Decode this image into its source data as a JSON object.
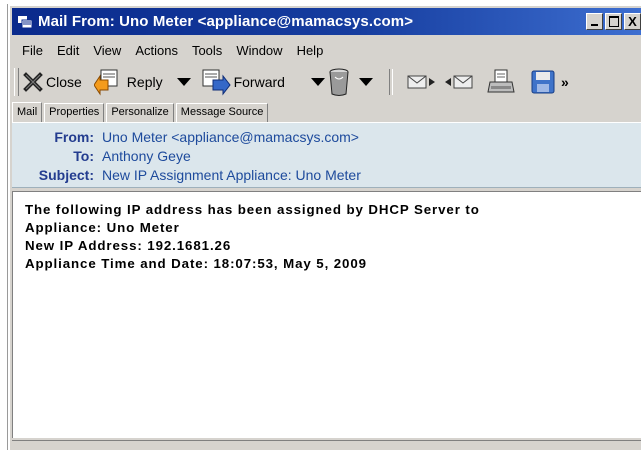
{
  "window": {
    "title": "Mail From: Uno Meter <appliance@mamacsys.com>"
  },
  "menu": [
    "File",
    "Edit",
    "View",
    "Actions",
    "Tools",
    "Window",
    "Help"
  ],
  "toolbar": {
    "close_label": "Close",
    "reply_label": "Reply",
    "forward_label": "Forward",
    "overflow_label": "»"
  },
  "tabs": [
    "Mail",
    "Properties",
    "Personalize",
    "Message Source"
  ],
  "header": {
    "from_label": "From:",
    "from_value": "Uno Meter <appliance@mamacsys.com>",
    "to_label": "To:",
    "to_value": "Anthony Geye",
    "subject_label": "Subject:",
    "subject_value": "New IP Assignment Appliance: Uno Meter"
  },
  "body": {
    "lines": [
      "The following IP address has been assigned by DHCP Server to",
      "Appliance: Uno Meter",
      "New IP Address: 192.1681.26",
      "Appliance Time and Date: 18:07:53, May 5, 2009"
    ]
  },
  "colors": {
    "titlebar_start": "#0a2a8c",
    "titlebar_end": "#3d6ed0",
    "header_bg": "#dbe6ec",
    "header_text": "#1d4a9c"
  },
  "icons": {
    "app": "mail-window-icon",
    "close": "close-x-icon",
    "reply": "reply-arrow-icon",
    "forward": "forward-arrow-icon",
    "delete": "trash-can-icon",
    "prev": "previous-message-icon",
    "next": "next-message-icon",
    "print": "printer-icon",
    "save": "floppy-disk-icon"
  }
}
